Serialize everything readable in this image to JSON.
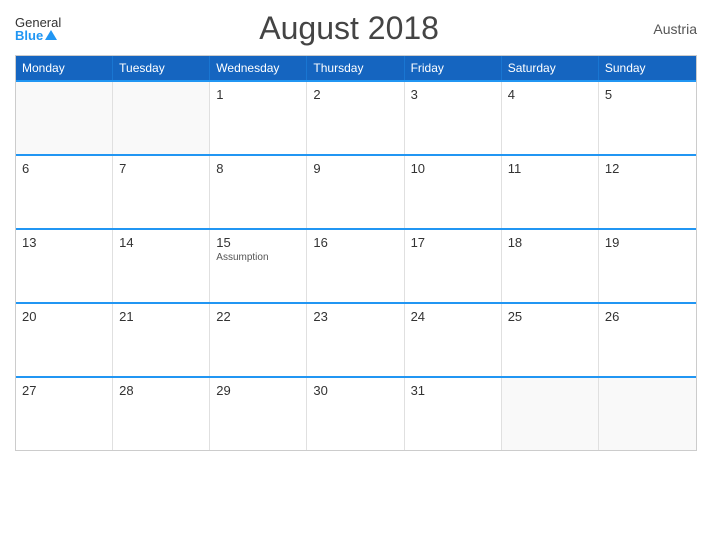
{
  "header": {
    "logo_general": "General",
    "logo_blue": "Blue",
    "title": "August 2018",
    "country": "Austria"
  },
  "days": [
    "Monday",
    "Tuesday",
    "Wednesday",
    "Thursday",
    "Friday",
    "Saturday",
    "Sunday"
  ],
  "weeks": [
    [
      {
        "num": "",
        "empty": true
      },
      {
        "num": "",
        "empty": true
      },
      {
        "num": "1"
      },
      {
        "num": "2"
      },
      {
        "num": "3"
      },
      {
        "num": "4"
      },
      {
        "num": "5"
      }
    ],
    [
      {
        "num": "6"
      },
      {
        "num": "7"
      },
      {
        "num": "8"
      },
      {
        "num": "9"
      },
      {
        "num": "10"
      },
      {
        "num": "11"
      },
      {
        "num": "12"
      }
    ],
    [
      {
        "num": "13"
      },
      {
        "num": "14"
      },
      {
        "num": "15",
        "holiday": "Assumption"
      },
      {
        "num": "16"
      },
      {
        "num": "17"
      },
      {
        "num": "18"
      },
      {
        "num": "19"
      }
    ],
    [
      {
        "num": "20"
      },
      {
        "num": "21"
      },
      {
        "num": "22"
      },
      {
        "num": "23"
      },
      {
        "num": "24"
      },
      {
        "num": "25"
      },
      {
        "num": "26"
      }
    ],
    [
      {
        "num": "27"
      },
      {
        "num": "28"
      },
      {
        "num": "29"
      },
      {
        "num": "30"
      },
      {
        "num": "31"
      },
      {
        "num": "",
        "empty": true
      },
      {
        "num": "",
        "empty": true
      }
    ]
  ]
}
